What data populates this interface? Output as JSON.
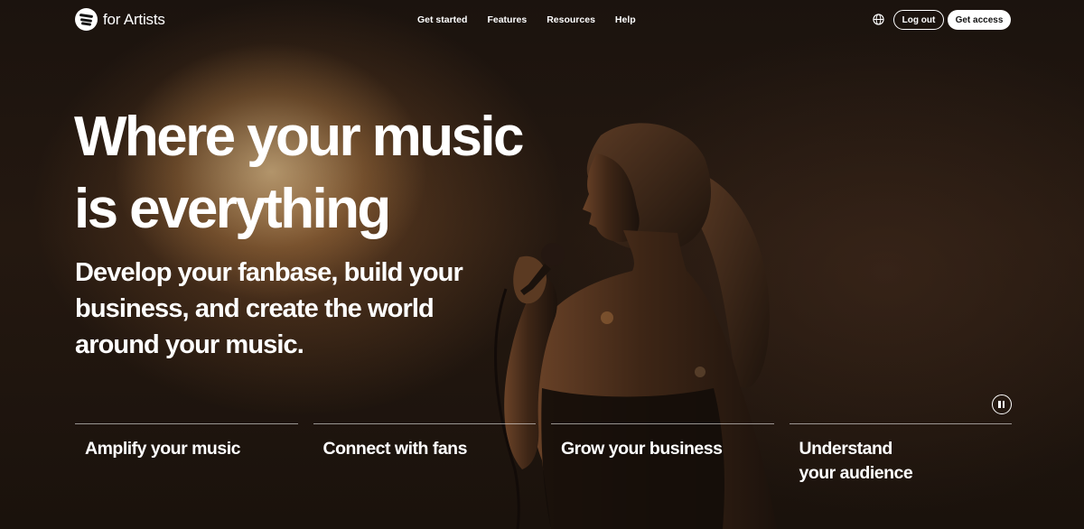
{
  "nav": {
    "logo_text": "for Artists",
    "links": [
      "Get started",
      "Features",
      "Resources",
      "Help"
    ],
    "logout_label": "Log out",
    "access_label": "Get access"
  },
  "hero": {
    "headline_line1": "Where your music",
    "headline_line2": "is everything",
    "subhead_line1": "Develop your fanbase, build your",
    "subhead_line2": "business, and create the world",
    "subhead_line3": "around your music."
  },
  "features": [
    {
      "line1": "Amplify your music",
      "line2": ""
    },
    {
      "line1": "Connect with fans",
      "line2": ""
    },
    {
      "line1": "Grow your business",
      "line2": ""
    },
    {
      "line1": "Understand",
      "line2": "your audience"
    }
  ],
  "colors": {
    "background": "#1a120d",
    "text": "#ffffff",
    "button_dark_text": "#121212"
  },
  "icons": [
    "spotify-logo-icon",
    "globe-icon",
    "pause-icon"
  ]
}
